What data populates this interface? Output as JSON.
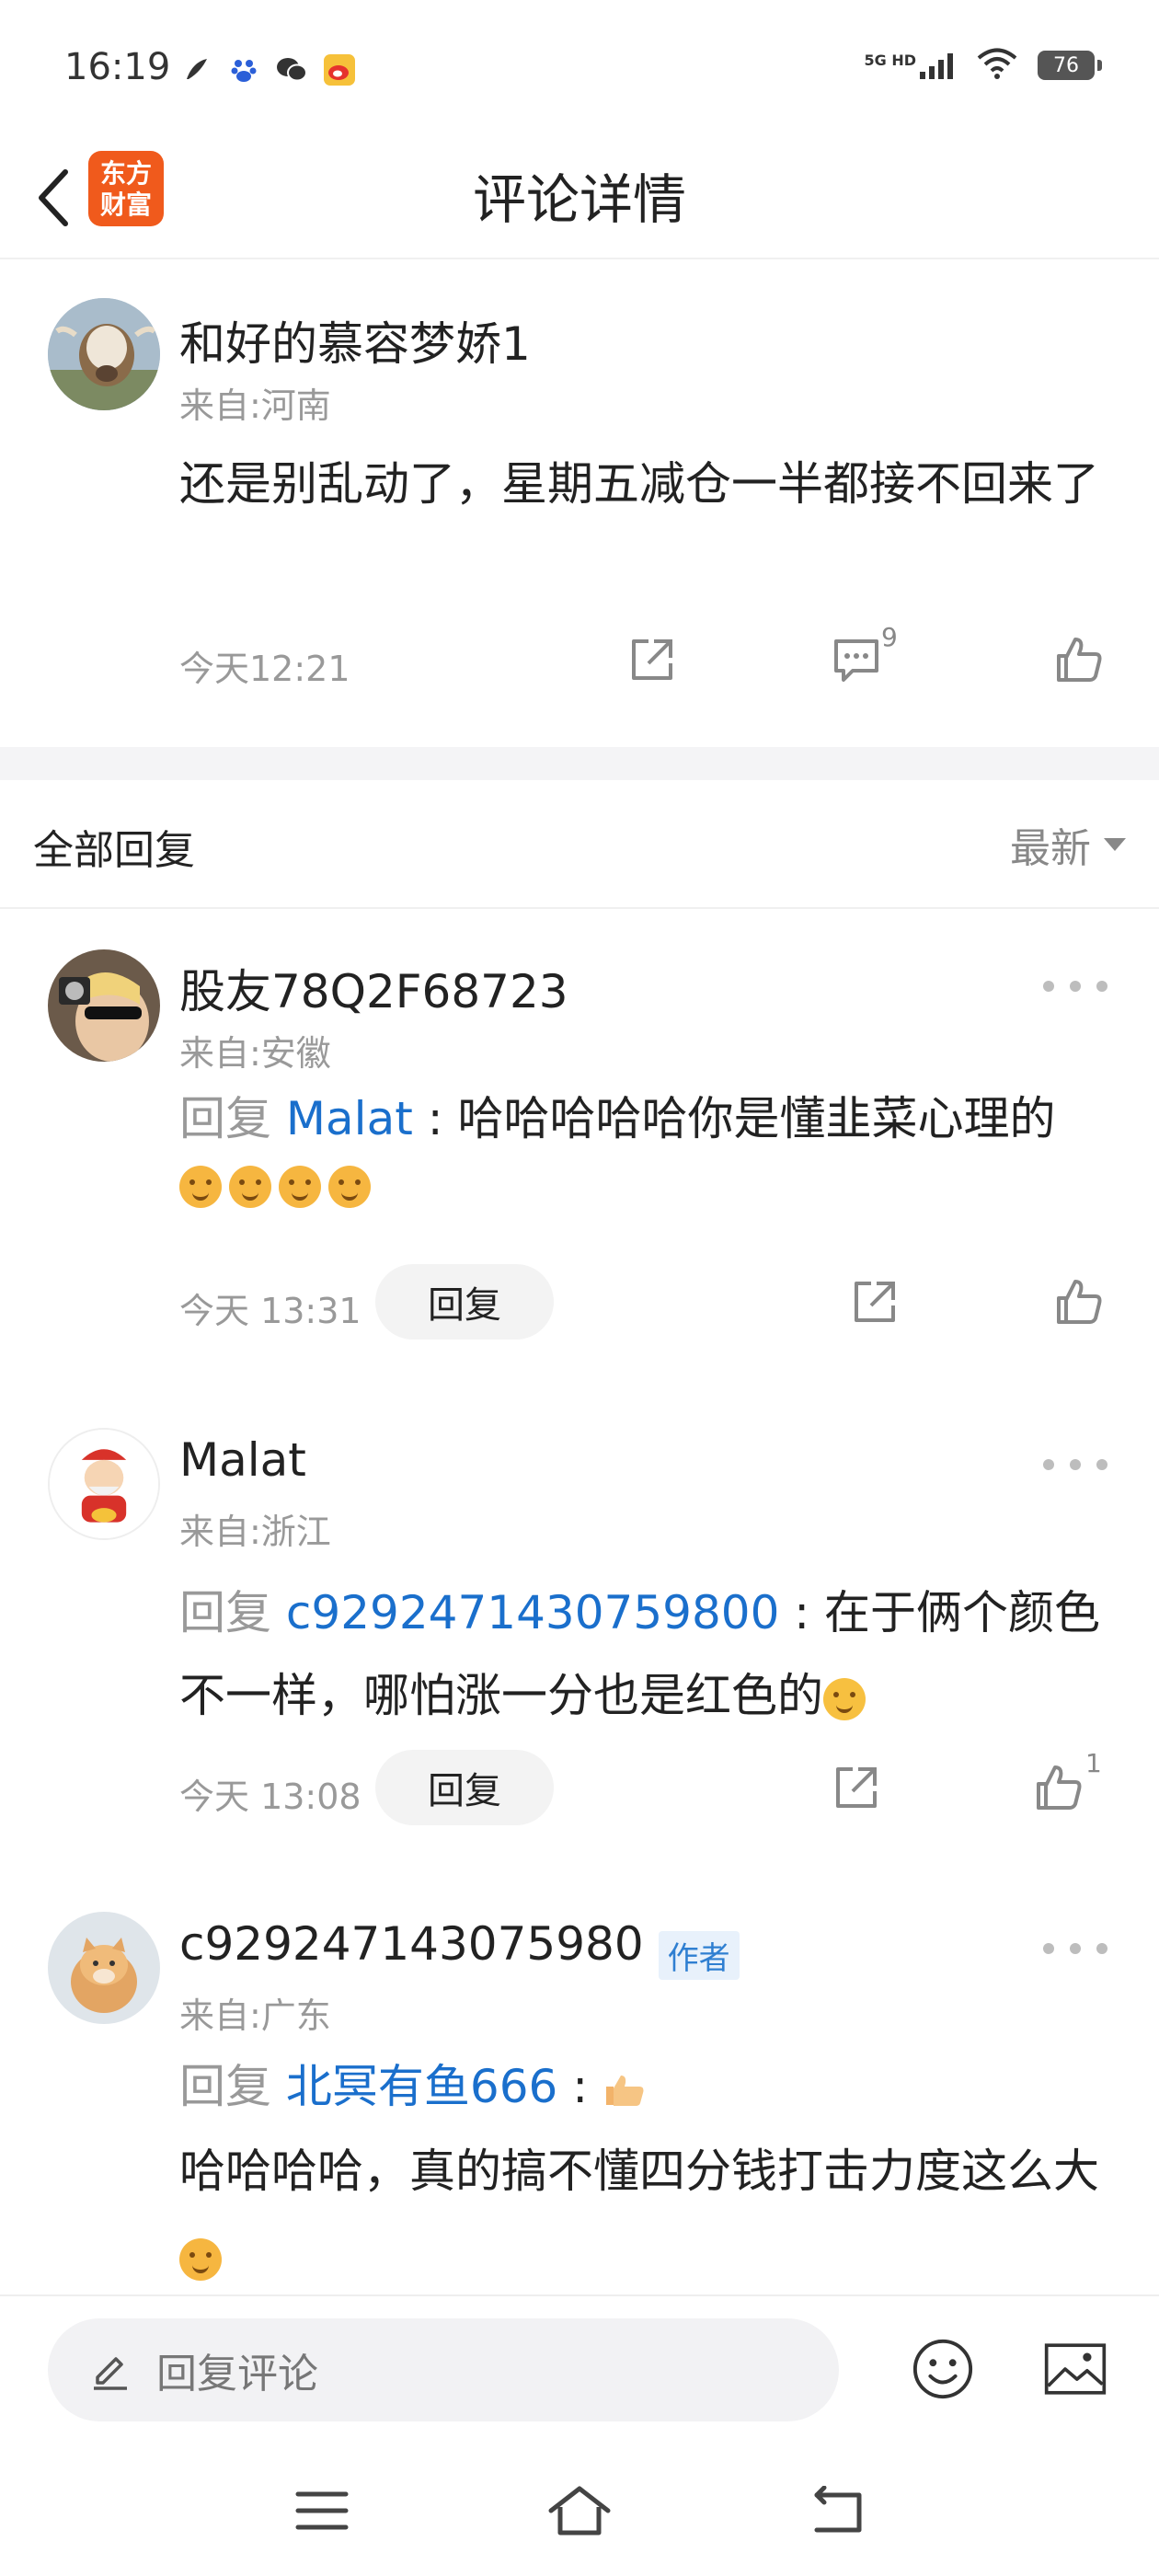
{
  "status_bar": {
    "time": "16:19",
    "network": "5G HD",
    "battery": "76",
    "apps": [
      "feather-app-icon",
      "baidu-app-icon",
      "wechat-app-icon",
      "weibo-app-icon"
    ]
  },
  "header": {
    "logo_text_line1": "东方",
    "logo_text_line2": "财富",
    "title": "评论详情",
    "brand_color": "#f05a1c"
  },
  "main_comment": {
    "username": "和好的慕容梦娇1",
    "location": "来自:河南",
    "content": "还是别乱动了，星期五减仓一半都接不回来了",
    "time": "今天12:21",
    "comment_count": "9"
  },
  "replies_section": {
    "title": "全部回复",
    "sort_label": "最新"
  },
  "replies": [
    {
      "username": "股友78Q2F68723",
      "location": "来自:安徽",
      "reply_prefix": "回复",
      "mention": "Malat",
      "separator": " : ",
      "content": "哈哈哈哈哈你是懂韭菜心理的",
      "time": "今天 13:31",
      "reply_label": "回复"
    },
    {
      "username": "Malat",
      "location": "来自:浙江",
      "reply_prefix": "回复",
      "mention": "c9292471430759800",
      "separator": " : ",
      "content_line1": "在于俩个颜色",
      "content_line2": "不一样，哪怕涨一分也是红色的",
      "time": "今天 13:08",
      "reply_label": "回复",
      "like_count": "1"
    },
    {
      "username": "c929247143075980",
      "badge": "作者",
      "location": "来自:广东",
      "reply_prefix": "回复",
      "mention": "北冥有鱼666",
      "separator": " : ",
      "content": "哈哈哈哈，真的搞不懂四分钱打击力度这么大"
    }
  ],
  "bottom_bar": {
    "input_placeholder": "回复评论"
  },
  "colors": {
    "mention": "#1a6fcc",
    "secondary_text": "#999999"
  }
}
